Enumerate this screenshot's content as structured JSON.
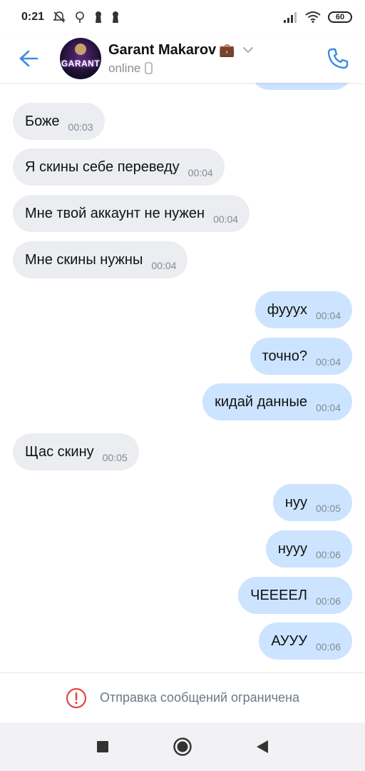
{
  "status_bar": {
    "time": "0:21",
    "battery": "60"
  },
  "header": {
    "contact_name": "Garant Makarov",
    "status": "online",
    "avatar_label": "GARANT",
    "accent": "#3f8ae0"
  },
  "messages": [
    {
      "direction": "in",
      "text": "Боже",
      "time": "00:03"
    },
    {
      "direction": "in",
      "text": "Я скины себе переведу",
      "time": "00:04"
    },
    {
      "direction": "in",
      "text": "Мне твой аккаунт не нужен",
      "time": "00:04"
    },
    {
      "direction": "in",
      "text": "Мне скины нужны",
      "time": "00:04"
    },
    {
      "direction": "out",
      "text": "фууух",
      "time": "00:04"
    },
    {
      "direction": "out",
      "text": "точно?",
      "time": "00:04"
    },
    {
      "direction": "out",
      "text": "кидай данные",
      "time": "00:04"
    },
    {
      "direction": "in",
      "text": "Щас скину",
      "time": "00:05"
    },
    {
      "direction": "out",
      "text": "нуу",
      "time": "00:05"
    },
    {
      "direction": "out",
      "text": "нууу",
      "time": "00:06"
    },
    {
      "direction": "out",
      "text": "ЧЕЕЕЕЛ",
      "time": "00:06"
    },
    {
      "direction": "out",
      "text": "АУУУ",
      "time": "00:06"
    }
  ],
  "restricted": {
    "text": "Отправка сообщений ограничена",
    "icon": "exclamation-circle-icon",
    "color": "#e64646"
  },
  "colors": {
    "incoming_bubble": "#ebedf0",
    "outgoing_bubble": "#cce4ff"
  }
}
